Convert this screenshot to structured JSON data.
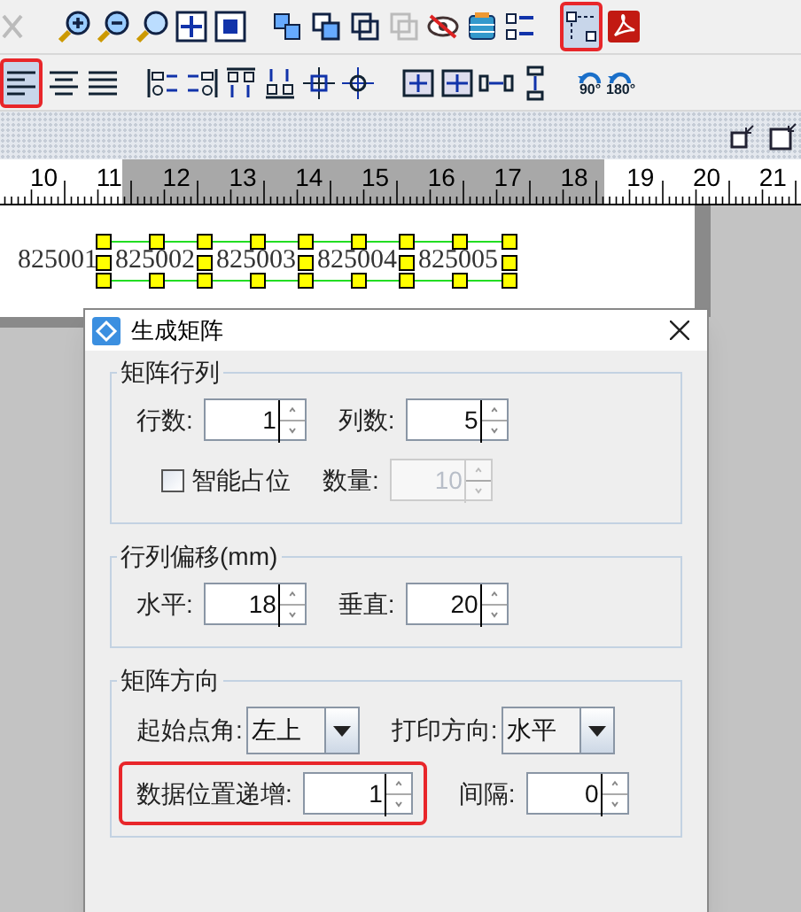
{
  "toolbar_1": [
    {
      "kind": "cut",
      "selected": false
    },
    {
      "kind": "zoom-in",
      "selected": false
    },
    {
      "kind": "zoom-out",
      "selected": false
    },
    {
      "kind": "zoom",
      "selected": false
    },
    {
      "kind": "fit",
      "selected": false
    },
    {
      "kind": "fit-page",
      "selected": false
    },
    {
      "kind": "group",
      "selected": false
    },
    {
      "kind": "ungroup",
      "selected": false
    },
    {
      "kind": "frame",
      "selected": false
    },
    {
      "kind": "frame-disabled",
      "selected": false
    },
    {
      "kind": "hide",
      "selected": false
    },
    {
      "kind": "database",
      "selected": false
    },
    {
      "kind": "checklist",
      "selected": false
    },
    {
      "kind": "matrix",
      "selected": true
    },
    {
      "kind": "pdf",
      "selected": false
    }
  ],
  "toolbar_2": [
    {
      "kind": "text-left",
      "selected": true
    },
    {
      "kind": "text-center",
      "selected": false
    },
    {
      "kind": "text-justify",
      "selected": false
    },
    {
      "kind": "align-left",
      "selected": false
    },
    {
      "kind": "align-right",
      "selected": false
    },
    {
      "kind": "align-top",
      "selected": false
    },
    {
      "kind": "align-bottom",
      "selected": false
    },
    {
      "kind": "center-h",
      "selected": false
    },
    {
      "kind": "center-v",
      "selected": false
    },
    {
      "kind": "same-width",
      "selected": false
    },
    {
      "kind": "same-height",
      "selected": false
    },
    {
      "kind": "space-h",
      "selected": false
    },
    {
      "kind": "space-v",
      "selected": false
    },
    {
      "kind": "rotate",
      "label": "90°",
      "selected": false
    },
    {
      "kind": "rotate",
      "label": "180°",
      "selected": false
    }
  ],
  "ruler": {
    "labels": [
      "10",
      "11",
      "12",
      "13",
      "14",
      "15",
      "16",
      "17",
      "18",
      "19",
      "20",
      "21"
    ]
  },
  "canvas": {
    "items": [
      {
        "text": "825001",
        "selected": false
      },
      {
        "text": "825002",
        "selected": true
      },
      {
        "text": "825003",
        "selected": true
      },
      {
        "text": "825004",
        "selected": true
      },
      {
        "text": "825005",
        "selected": true
      }
    ]
  },
  "dialog": {
    "title": "生成矩阵",
    "groups": [
      {
        "title": "矩阵行列",
        "rows": [
          [
            {
              "kind": "spinner",
              "label": "行数:",
              "value": "1",
              "disabled": false,
              "highlighted": false
            },
            {
              "kind": "spinner",
              "label": "列数:",
              "value": "5",
              "disabled": false,
              "highlighted": false
            }
          ],
          [
            {
              "kind": "checkbox",
              "label": "智能占位",
              "checked": false
            },
            {
              "kind": "spinner",
              "label": "数量:",
              "value": "10",
              "disabled": true,
              "highlighted": false
            }
          ]
        ]
      },
      {
        "title": "行列偏移(mm)",
        "rows": [
          [
            {
              "kind": "spinner",
              "label": "水平:",
              "value": "18",
              "disabled": false,
              "highlighted": false
            },
            {
              "kind": "spinner",
              "label": "垂直:",
              "value": "20",
              "disabled": false,
              "highlighted": false
            }
          ]
        ]
      },
      {
        "title": "矩阵方向",
        "rows": [
          [
            {
              "kind": "dropdown",
              "label": "起始点角:",
              "value": "左上"
            },
            {
              "kind": "dropdown",
              "label": "打印方向:",
              "value": "水平"
            }
          ],
          [
            {
              "kind": "spinner",
              "label": "数据位置递增:",
              "value": "1",
              "disabled": false,
              "highlighted": true
            },
            {
              "kind": "spinner",
              "label": "间隔:",
              "value": "0",
              "disabled": false,
              "highlighted": false
            }
          ]
        ]
      }
    ]
  }
}
